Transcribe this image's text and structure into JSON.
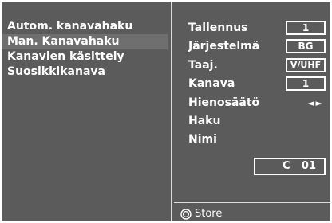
{
  "menu": {
    "items": [
      {
        "label": "Autom. kanavahaku"
      },
      {
        "label": "Man. Kanavahaku",
        "selected": true
      },
      {
        "label": "Kanavien käsittely"
      },
      {
        "label": "Suosikkikanava"
      }
    ]
  },
  "settings": {
    "rows": {
      "tallennus": {
        "label": "Tallennus",
        "value": "1"
      },
      "jarjestelma": {
        "label": "Järjestelmä",
        "value": "BG"
      },
      "taaj": {
        "label": "Taaj.",
        "value": "V/UHF"
      },
      "kanava": {
        "label": "Kanava",
        "value": "1"
      },
      "hienosaato": {
        "label": "Hienosäätö",
        "value": "◄►"
      },
      "haku": {
        "label": "Haku"
      },
      "nimi": {
        "label": "Nimi"
      }
    },
    "name_field": {
      "channel_prefix": "C",
      "number": "01"
    }
  },
  "footer": {
    "store_icon": "ok-button-icon",
    "store_label": "Store"
  },
  "colors": {
    "panel": "#5b5b5b",
    "selected_row": "#6f6f6f",
    "text": "#ffffff",
    "divider": "#d9d9d9"
  }
}
